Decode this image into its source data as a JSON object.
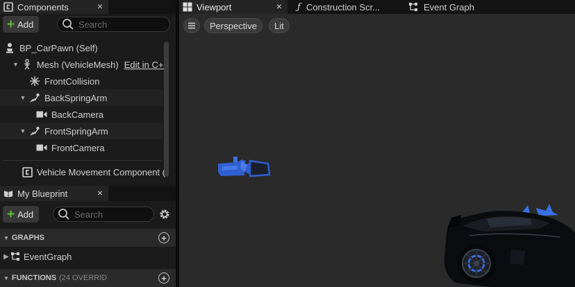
{
  "components_panel": {
    "tab_label": "Components",
    "close_glyph": "×",
    "add_label": "Add",
    "search_placeholder": "Search",
    "tree": [
      {
        "label": "BP_CarPawn (Self)",
        "icon": "pawn-icon"
      },
      {
        "label": "Mesh (VehicleMesh)",
        "icon": "skeletal-mesh-icon",
        "link": "Edit in C++"
      },
      {
        "label": "FrontCollision",
        "icon": "collision-icon"
      },
      {
        "label": "BackSpringArm",
        "icon": "spring-arm-icon"
      },
      {
        "label": "BackCamera",
        "icon": "camera-icon"
      },
      {
        "label": "FrontSpringArm",
        "icon": "spring-arm-icon"
      },
      {
        "label": "FrontCamera",
        "icon": "camera-icon"
      },
      {
        "label": "Vehicle Movement Component (",
        "icon": "component-icon"
      }
    ]
  },
  "blueprint_panel": {
    "tab_label": "My Blueprint",
    "close_glyph": "×",
    "add_label": "Add",
    "search_placeholder": "Search",
    "graphs_header": "GRAPHS",
    "graph_items": [
      "EventGraph"
    ],
    "functions_header": "FUNCTIONS",
    "functions_note": "(24 OVERRID"
  },
  "editor_tabs": [
    {
      "label": "Viewport",
      "active": true,
      "icon": "viewport-grid-icon",
      "close_glyph": "×"
    },
    {
      "label": "Construction Scr...",
      "active": false,
      "icon": "function-icon"
    },
    {
      "label": "Event Graph",
      "active": false,
      "icon": "graph-icon"
    }
  ],
  "viewport": {
    "menu_icon": "hamburger-icon",
    "view_mode": "Perspective",
    "lighting_mode": "Lit"
  },
  "colors": {
    "accent_add": "#5fbe38",
    "camera_blue": "#2f5fd0",
    "viewport_bg": "#2a2a2a"
  }
}
